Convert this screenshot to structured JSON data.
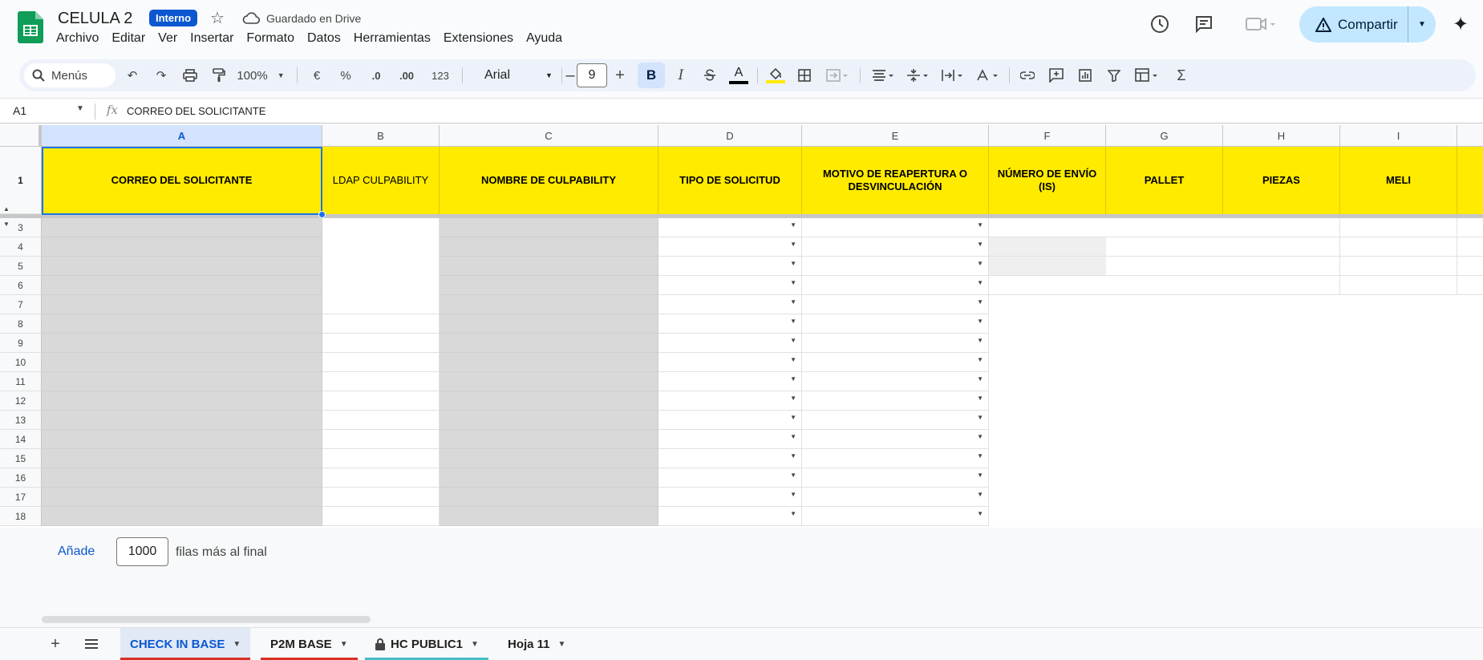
{
  "app": {
    "title": "CELULA 2",
    "badge": "Interno",
    "saved_status": "Guardado en Drive"
  },
  "menu": [
    "Archivo",
    "Editar",
    "Ver",
    "Insertar",
    "Formato",
    "Datos",
    "Herramientas",
    "Extensiones",
    "Ayuda"
  ],
  "share": {
    "label": "Compartir"
  },
  "toolbar": {
    "search": "Menús",
    "zoom": "100%",
    "currency": "€",
    "percent": "%",
    "dec_minus": ".0",
    "dec_plus": ".00",
    "format_num": "123",
    "font": "Arial",
    "font_size": "9",
    "bold": "B",
    "italic": "I"
  },
  "formula_bar": {
    "cell_ref": "A1",
    "content": "CORREO DEL SOLICITANTE"
  },
  "columns": [
    "A",
    "B",
    "C",
    "D",
    "E",
    "F",
    "G",
    "H",
    "I"
  ],
  "header_row": {
    "row_number": "1",
    "cells": [
      "CORREO DEL SOLICITANTE",
      "LDAP CULPABILITY",
      "NOMBRE DE CULPABILITY",
      "TIPO DE SOLICITUD",
      "MOTIVO DE REAPERTURA O DESVINCULACIÓN",
      "NÚMERO DE ENVÍO (IS)",
      "PALLET",
      "PIEZAS",
      "MELI"
    ]
  },
  "rows": [
    "3",
    "4",
    "5",
    "6",
    "7",
    "8",
    "9",
    "10",
    "11",
    "12",
    "13",
    "14",
    "15",
    "16",
    "17",
    "18"
  ],
  "add_rows": {
    "link": "Añade",
    "count": "1000",
    "suffix": "filas más al final"
  },
  "sheets": [
    {
      "name": "CHECK IN BASE",
      "active": true,
      "color": "#d93025"
    },
    {
      "name": "P2M BASE",
      "active": false,
      "color": "#d93025"
    },
    {
      "name": "HC PUBLIC1",
      "active": false,
      "color": "#46bdc6",
      "locked": true
    },
    {
      "name": "Hoja 11",
      "active": false,
      "color": ""
    }
  ]
}
